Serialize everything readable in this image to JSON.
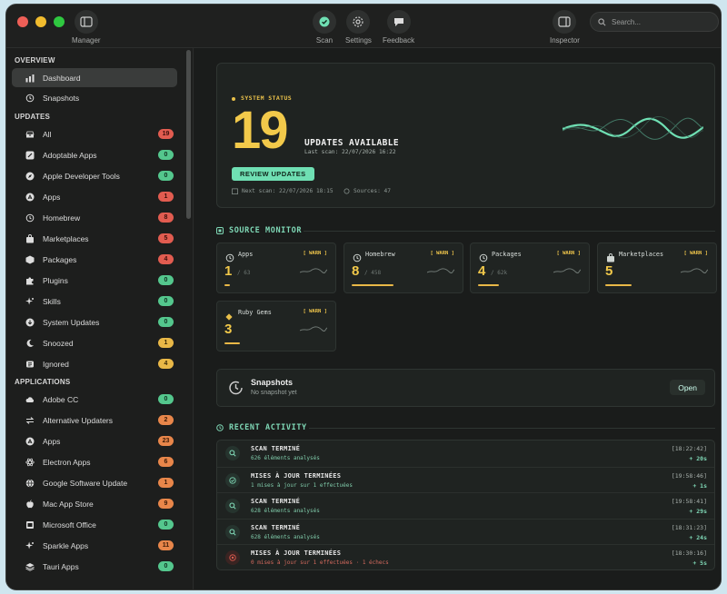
{
  "toolbar": {
    "manager_label": "Manager",
    "scan_label": "Scan",
    "settings_label": "Settings",
    "feedback_label": "Feedback",
    "inspector_label": "Inspector",
    "search_placeholder": "Search..."
  },
  "sidebar": {
    "overview_heading": "OVERVIEW",
    "overview_items": [
      {
        "label": "Dashboard",
        "icon": "chart-icon",
        "active": true
      },
      {
        "label": "Snapshots",
        "icon": "history-icon"
      }
    ],
    "updates_heading": "UPDATES",
    "updates_items": [
      {
        "label": "All",
        "icon": "tray-icon",
        "badge": "19",
        "badge_color": "red"
      },
      {
        "label": "Adoptable Apps",
        "icon": "link-icon",
        "badge": "0",
        "badge_color": "green"
      },
      {
        "label": "Apple Developer Tools",
        "icon": "compass-icon",
        "badge": "0",
        "badge_color": "green"
      },
      {
        "label": "Apps",
        "icon": "appstore-icon",
        "badge": "1",
        "badge_color": "red"
      },
      {
        "label": "Homebrew",
        "icon": "history-icon",
        "badge": "8",
        "badge_color": "red"
      },
      {
        "label": "Marketplaces",
        "icon": "bag-icon",
        "badge": "5",
        "badge_color": "red"
      },
      {
        "label": "Packages",
        "icon": "box-icon",
        "badge": "4",
        "badge_color": "red"
      },
      {
        "label": "Plugins",
        "icon": "puzzle-icon",
        "badge": "0",
        "badge_color": "green"
      },
      {
        "label": "Skills",
        "icon": "sparkle-icon",
        "badge": "0",
        "badge_color": "green"
      },
      {
        "label": "System Updates",
        "icon": "download-icon",
        "badge": "0",
        "badge_color": "green"
      },
      {
        "label": "Snoozed",
        "icon": "moon-icon",
        "badge": "1",
        "badge_color": "yellow"
      },
      {
        "label": "Ignored",
        "icon": "ignore-icon",
        "badge": "4",
        "badge_color": "yellow"
      }
    ],
    "applications_heading": "APPLICATIONS",
    "applications_items": [
      {
        "label": "Adobe CC",
        "icon": "cloud-icon",
        "badge": "0",
        "badge_color": "green"
      },
      {
        "label": "Alternative Updaters",
        "icon": "arrows-icon",
        "badge": "2",
        "badge_color": "orange"
      },
      {
        "label": "Apps",
        "icon": "appstore-icon",
        "badge": "23",
        "badge_color": "orange"
      },
      {
        "label": "Electron Apps",
        "icon": "atom-icon",
        "badge": "6",
        "badge_color": "orange"
      },
      {
        "label": "Google Software Update",
        "icon": "globe-icon",
        "badge": "1",
        "badge_color": "orange"
      },
      {
        "label": "Mac App Store",
        "icon": "apple-icon",
        "badge": "9",
        "badge_color": "orange"
      },
      {
        "label": "Microsoft Office",
        "icon": "office-icon",
        "badge": "0",
        "badge_color": "green"
      },
      {
        "label": "Sparkle Apps",
        "icon": "sparkle-icon",
        "badge": "11",
        "badge_color": "orange"
      },
      {
        "label": "Tauri Apps",
        "icon": "layers-icon",
        "badge": "0",
        "badge_color": "green"
      }
    ]
  },
  "status": {
    "label": "SYSTEM STATUS",
    "count": "19",
    "title": "UPDATES AVAILABLE",
    "last_scan": "Last scan: 22/07/2026 16:22",
    "review_button": "REVIEW UPDATES",
    "next_scan": "Next scan: 22/07/2026 18:15",
    "sources": "Sources: 47"
  },
  "source_monitor": {
    "title": "SOURCE MONITOR",
    "cards": [
      {
        "name": "Apps",
        "icon": "history-icon",
        "warn": "[ WARN ]",
        "count": "1",
        "total": "/ 63",
        "fill": 0.05
      },
      {
        "name": "Homebrew",
        "icon": "history-icon",
        "warn": "[ WARN ]",
        "count": "8",
        "total": "/ 458",
        "fill": 0.4
      },
      {
        "name": "Packages",
        "icon": "history-icon",
        "warn": "[ WARN ]",
        "count": "4",
        "total": "/ 62k",
        "fill": 0.2
      },
      {
        "name": "Marketplaces",
        "icon": "bag-icon",
        "warn": "[ WARN ]",
        "count": "5",
        "total": "",
        "fill": 0.25
      },
      {
        "name": "Ruby Gems",
        "icon": "gem-icon",
        "warn": "[ WARN ]",
        "count": "3",
        "total": "",
        "fill": 0.15
      }
    ]
  },
  "snapshots": {
    "title": "Snapshots",
    "subtitle": "No snapshot yet",
    "open_button": "Open"
  },
  "activity": {
    "title": "RECENT ACTIVITY",
    "rows": [
      {
        "title": "SCAN TERMINÉ",
        "sub": "626 éléments analysés",
        "time": "[18:22:42]",
        "dur": "+ 20s",
        "icon": "search-icon",
        "error": false
      },
      {
        "title": "MISES À JOUR TERMINÉES",
        "sub": "1 mises à jour sur 1 effectuées",
        "time": "[19:58:46]",
        "dur": "+ 1s",
        "icon": "check-icon",
        "error": false
      },
      {
        "title": "SCAN TERMINÉ",
        "sub": "628 éléments analysés",
        "time": "[19:58:41]",
        "dur": "+ 29s",
        "icon": "search-icon",
        "error": false
      },
      {
        "title": "SCAN TERMINÉ",
        "sub": "628 éléments analysés",
        "time": "[18:31:23]",
        "dur": "+ 24s",
        "icon": "search-icon",
        "error": false
      },
      {
        "title": "MISES À JOUR TERMINÉES",
        "sub": "0 mises à jour sur 1 effectuées · 1 échecs",
        "time": "[18:30:16]",
        "dur": "+ 5s",
        "icon": "error-icon",
        "error": true
      }
    ]
  },
  "colors": {
    "accent_yellow": "#f2c94a",
    "accent_green": "#6fdfb3",
    "badge_red": "#e25c50"
  }
}
